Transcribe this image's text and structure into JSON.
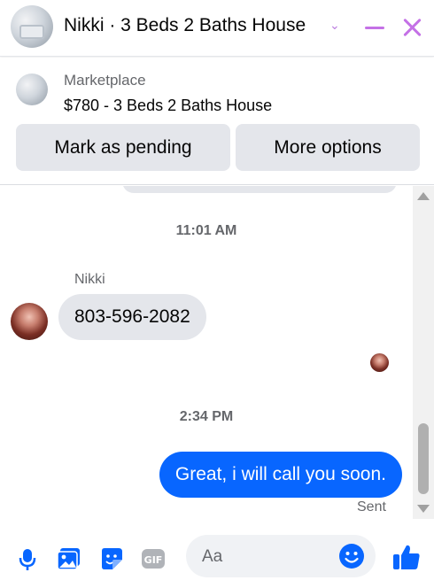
{
  "header": {
    "title": "Nikki · 3 Beds 2 Baths House",
    "chevron_icon": "chevron-down-icon",
    "minimize_icon": "minimize-icon",
    "close_icon": "close-icon",
    "accent_color": "#c471e6"
  },
  "listing": {
    "label": "Marketplace",
    "title": "$780 - 3 Beds 2 Baths House",
    "mark_pending_label": "Mark as pending",
    "more_options_label": "More options"
  },
  "chat": {
    "timestamp_1": "11:01 AM",
    "sender_name": "Nikki",
    "incoming_message": "803-596-2082",
    "timestamp_2": "2:34 PM",
    "outgoing_message": "Great, i will call you soon.",
    "status": "Sent",
    "outgoing_color": "#0866ff"
  },
  "composer": {
    "placeholder": "Aa",
    "icons": [
      "microphone-icon",
      "photo-icon",
      "sticker-icon",
      "gif-icon",
      "emoji-icon",
      "thumbs-up-icon"
    ],
    "gif_label": "GIF",
    "accent_color": "#0866ff"
  }
}
